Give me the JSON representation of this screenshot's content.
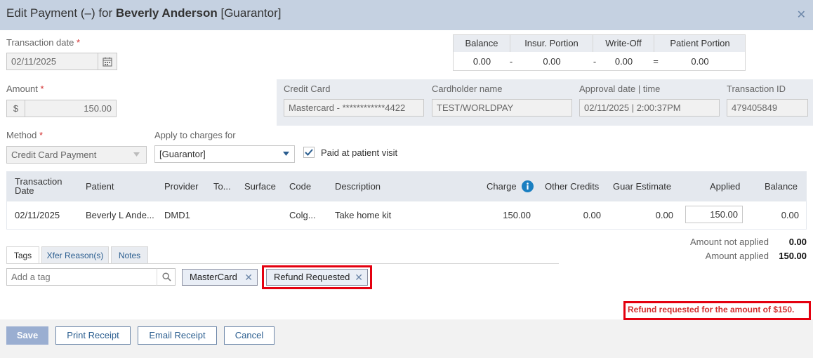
{
  "header": {
    "title_prefix": "Edit Payment (–) for ",
    "patient_name": "Beverly Anderson",
    "role": " [Guarantor]",
    "close_symbol": "✕"
  },
  "transaction_date": {
    "label": "Transaction date",
    "required": "*",
    "value": "02/11/2025"
  },
  "amount": {
    "label": "Amount",
    "required": "*",
    "currency": "$",
    "value": "150.00"
  },
  "method": {
    "label": "Method",
    "required": "*",
    "value": "Credit Card Payment"
  },
  "apply_to": {
    "label": "Apply to charges for",
    "value": "[Guarantor]"
  },
  "paid_at_visit": {
    "label": "Paid at patient visit",
    "checked": true
  },
  "summary": {
    "headers": [
      "Balance",
      "Insur. Portion",
      "Write-Off",
      "Patient Portion"
    ],
    "values": [
      "0.00",
      "0.00",
      "0.00",
      "0.00"
    ],
    "operators": [
      "-",
      "-",
      "="
    ]
  },
  "card": {
    "credit_card_label": "Credit Card",
    "credit_card_value": "Mastercard - ************4422",
    "cardholder_label": "Cardholder name",
    "cardholder_value": "TEST/WORLDPAY",
    "approval_label": "Approval date | time",
    "approval_value": "02/11/2025 | 2:00:37PM",
    "transaction_id_label": "Transaction ID",
    "transaction_id_value": "479405849"
  },
  "grid": {
    "headers": {
      "transaction_date": "Transaction Date",
      "patient": "Patient",
      "provider": "Provider",
      "tooth": "To...",
      "surface": "Surface",
      "code": "Code",
      "description": "Description",
      "charge": "Charge",
      "other_credits": "Other Credits",
      "guar_estimate": "Guar Estimate",
      "applied": "Applied",
      "balance": "Balance"
    },
    "rows": [
      {
        "transaction_date": "02/11/2025",
        "patient": "Beverly L Ande...",
        "provider": "DMD1",
        "tooth": "",
        "surface": "",
        "code": "Colg...",
        "description": "Take home kit",
        "charge": "150.00",
        "other_credits": "0.00",
        "guar_estimate": "0.00",
        "applied": "150.00",
        "balance": "0.00"
      }
    ]
  },
  "totals": {
    "not_applied_label": "Amount not applied",
    "not_applied_value": "0.00",
    "applied_label": "Amount applied",
    "applied_value": "150.00"
  },
  "tabs": [
    "Tags",
    "Xfer Reason(s)",
    "Notes"
  ],
  "tags": {
    "placeholder": "Add a tag",
    "chips": [
      "MasterCard",
      "Refund Requested"
    ]
  },
  "refund_notice": "Refund requested for the amount of $150.",
  "buttons": {
    "save": "Save",
    "print_receipt": "Print Receipt",
    "email_receipt": "Email Receipt",
    "cancel": "Cancel"
  },
  "colors": {
    "header_bg": "#c5d1e1",
    "accent": "#2a5d8f",
    "highlight": "#e4000f",
    "info_icon": "#1a7fc1"
  },
  "icons": {
    "calendar": "calendar-icon",
    "search": "search-icon",
    "dropdown": "chevron-down-icon",
    "info": "info-icon",
    "checkbox": "checkmark-icon",
    "close": "close-icon"
  }
}
